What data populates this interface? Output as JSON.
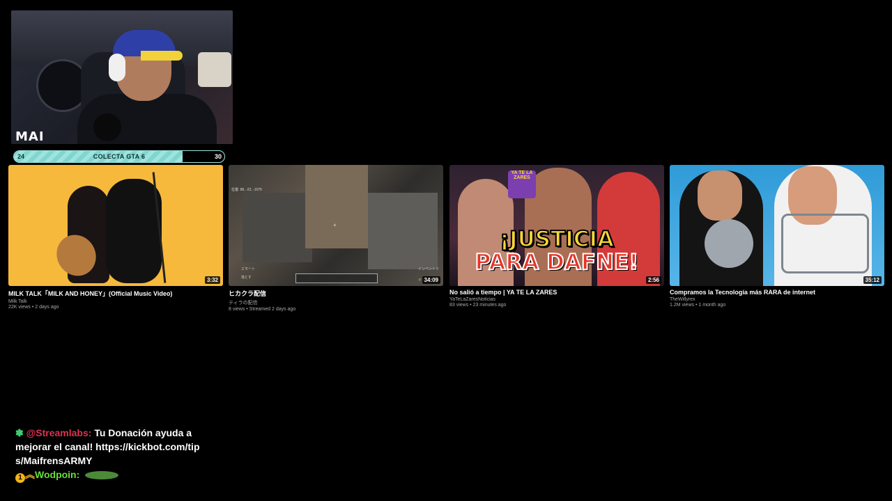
{
  "webcam": {
    "label": "MAI"
  },
  "goal": {
    "start": "24",
    "label": "COLECTA GTA 6",
    "end": "30",
    "progress_fraction": 0.8
  },
  "videos": [
    {
      "title": "MILK TALK「MILK AND HONEY」(Official Music Video)",
      "channel": "Milk Talk",
      "meta": "22K views • 2 days ago",
      "duration": "3:32"
    },
    {
      "title": "ヒカクラ配信",
      "channel": "ティラの配信",
      "meta": "8 views • Streamed 2 days ago",
      "duration": "34:09",
      "overlay": {
        "coords": "位置: 86, -22, -1075",
        "left_hud_1": "エモート",
        "left_hud_2": "落とす",
        "right_hud_1": "インベントリ",
        "right_hud_2": "ドア"
      }
    },
    {
      "title": "No salió a tiempo | YA TE LA ZARES",
      "channel": "YaTeLaZaresNoticias",
      "meta": "83 views • 23 minutes ago",
      "duration": "2:56",
      "headline_1": "¡JUSTICIA",
      "headline_2": "PARA DAFNE!",
      "sign": "YA TE LA ZARES"
    },
    {
      "title": "Compramos la Tecnología más RARA de internet",
      "channel": "TheWillyrex",
      "meta": "1.2M views • 1 month ago",
      "duration": "35:12"
    }
  ],
  "chat": {
    "messages": [
      {
        "user": "@Streamlabs:",
        "text": "Tu Donación ayuda a mejorar el canal! https://kickbot.com/tips/MaifrensARMY"
      },
      {
        "badge": "1",
        "user": "Wodpoin:",
        "text": ""
      }
    ]
  },
  "colors": {
    "background": "#000000",
    "goal_accent": "#7fd6cf",
    "streamlabs_user": "#e0304f",
    "wodpoin_user": "#66e03a"
  }
}
